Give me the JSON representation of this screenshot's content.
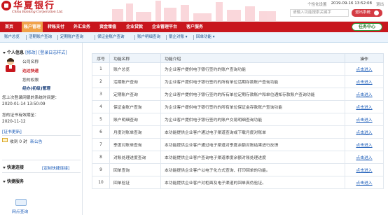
{
  "header": {
    "logo_cn": "华夏银行",
    "logo_en": "China Banking Corporation Ltd.",
    "top_links": [
      "个性化设置",
      "2019-09-16 13:52:08",
      "退出"
    ],
    "search_placeholder": "请输入功能搜索关键字",
    "search_button": "退出系统"
  },
  "nav": {
    "items": [
      "首页",
      "账户管理",
      "转账支付",
      "外汇业务",
      "资金增值",
      "企业贷款",
      "企业管理平台",
      "客户服务"
    ],
    "active_index": 1,
    "task_center": "任务中心"
  },
  "subnav": {
    "items": [
      "账户总览",
      "活期账户查询",
      "定期账户查询",
      "保证金账户查询",
      "账户明细查询",
      "银企对账 ▾",
      "回单功能 ▾"
    ]
  },
  "sidebar": {
    "personal_info_title": "个人信息",
    "modify_link": "[修改]",
    "login_log_link": "[登录日志样式]",
    "company_name_label": "公司名称",
    "company_name": "达达快递",
    "role_label": "您的权限",
    "role": "经办(初级)管理",
    "last_login_label": "您上次登录网银的系统时间是：",
    "last_login_time": "2020-01-14 13:50:09",
    "cert_expiry_label": "您的证书有效期至：",
    "cert_expiry_date": "2020-11-12",
    "cert_update_link": "[证书更新]",
    "message_text": "收到 0 封",
    "message_link": "新公告",
    "quick_link_title": "快速连接",
    "quick_link_action": "[定制快捷连接]",
    "service_title": "快捷服务",
    "service_item": "网点查询"
  },
  "table": {
    "headers": [
      "序号",
      "功能名称",
      "功能介绍",
      "操作"
    ],
    "rows": [
      {
        "no": "1",
        "name": "账户总览",
        "desc": "为企业客户提供电子银行签约的账户查询功能",
        "op": "点击进入"
      },
      {
        "no": "2",
        "name": "活期账户查询",
        "desc": "为企业客户提供电子银行签约的所有单位活期存款账户查询功能",
        "op": "点击进入"
      },
      {
        "no": "3",
        "name": "定期账户查询",
        "desc": "为企业客户提供电子银行签约的所有单位定期存款账户和单位通知存款账户查询功能",
        "op": "点击进入"
      },
      {
        "no": "4",
        "name": "保证金账户查询",
        "desc": "为企业客户提供电子银行签约的所有单位保证金存款账户查询功能",
        "op": "点击进入"
      },
      {
        "no": "5",
        "name": "账户明细查询",
        "desc": "为企业客户提供电子银行签约的账户交易明细查询功能",
        "op": "点击进入"
      },
      {
        "no": "6",
        "name": "月度对账单查询",
        "desc": "本功能提供企业客户通过电子渠道查询或下载月度对账单",
        "op": "点击进入"
      },
      {
        "no": "7",
        "name": "季度对账单查询",
        "desc": "本功能提供企业客户通过电子渠道对季度余额对账结果进行反馈",
        "op": "点击进入"
      },
      {
        "no": "8",
        "name": "对账处理进度查询",
        "desc": "本功能提供企业客户查询电子渠道季度余额对账处理进度",
        "op": "点击进入"
      },
      {
        "no": "9",
        "name": "回单查询",
        "desc": "本功能提供企业客户以电子化方式查询、打印回单的功能。",
        "op": "点击进入"
      },
      {
        "no": "10",
        "name": "回单验证",
        "desc": "本功能提供企业客户对柜面及电子渠道的回单真伪验证。",
        "op": "点击进入"
      }
    ]
  },
  "colors": {
    "brand_red": "#c8161d",
    "active_tab": "#f0a24b",
    "link_blue": "#1a5bb8"
  }
}
